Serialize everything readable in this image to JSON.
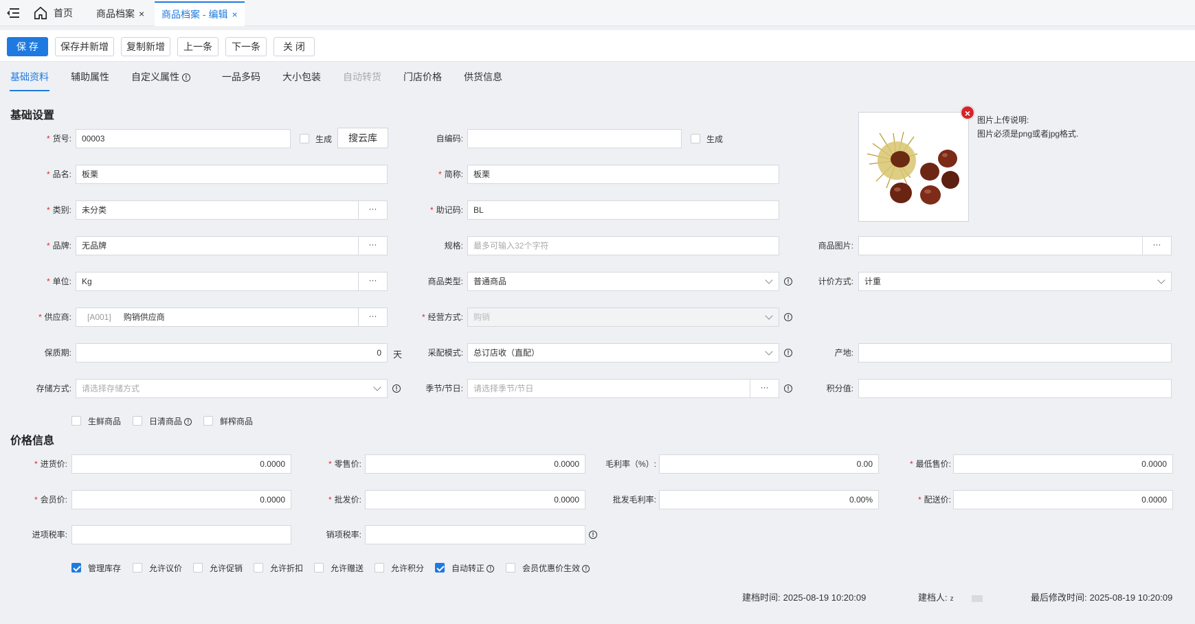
{
  "tabs": {
    "home": "首页",
    "items": [
      {
        "label": "商品档案",
        "close": "×"
      },
      {
        "label": "商品档案 - 编辑",
        "close": "×"
      }
    ]
  },
  "toolbar": {
    "save": "保 存",
    "save_new": "保存并新增",
    "copy_new": "复制新增",
    "prev": "上一条",
    "next": "下一条",
    "close": "关 闭"
  },
  "subtabs": [
    "基础资料",
    "辅助属性",
    "自定义属性",
    "一品多码",
    "大小包装",
    "自动转货",
    "门店价格",
    "供货信息"
  ],
  "basic": {
    "title": "基础设置",
    "required_mark": "*",
    "item_no": {
      "label": "货号:",
      "value": "00003",
      "gen_label": "生成",
      "search_btn": "搜云库"
    },
    "self_code": {
      "label": "自编码:",
      "value": "",
      "gen_label": "生成"
    },
    "name": {
      "label": "品名:",
      "value": "板栗"
    },
    "short_name": {
      "label": "简称:",
      "value": "板栗"
    },
    "category": {
      "label": "类别:",
      "value": "未分类"
    },
    "mnemonic": {
      "label": "助记码:",
      "value": "BL"
    },
    "brand": {
      "label": "品牌:",
      "value": "无品牌"
    },
    "spec": {
      "label": "规格:",
      "placeholder": "最多可输入32个字符"
    },
    "product_image": {
      "label": "商品图片:",
      "value": ""
    },
    "unit": {
      "label": "单位:",
      "value": "Kg"
    },
    "product_type": {
      "label": "商品类型:",
      "value": "普通商品"
    },
    "pricing_method": {
      "label": "计价方式:",
      "value": "计重"
    },
    "supplier": {
      "label": "供应商:",
      "code": "[A001]",
      "value": "购销供应商"
    },
    "business_mode": {
      "label": "经营方式:",
      "value": "购销"
    },
    "shelf_life": {
      "label": "保质期:",
      "value": "0",
      "unit": "天"
    },
    "purchase_mode": {
      "label": "采配模式:",
      "value": "总订店收（直配）"
    },
    "origin": {
      "label": "产地:",
      "value": ""
    },
    "storage": {
      "label": "存储方式:",
      "placeholder": "请选择存储方式"
    },
    "season": {
      "label": "季节/节日:",
      "placeholder": "请选择季节/节日"
    },
    "points": {
      "label": "积分值:",
      "value": ""
    },
    "dots": "···",
    "info": "!",
    "flags": [
      "生鲜商品",
      "日清商品",
      "鲜榨商品"
    ]
  },
  "image": {
    "note_title": "图片上传说明:",
    "note_text": "图片必须是png或者jpg格式.",
    "delete": "×"
  },
  "price": {
    "title": "价格信息",
    "purchase": {
      "label": "进货价:",
      "value": "0.0000"
    },
    "retail": {
      "label": "零售价:",
      "value": "0.0000"
    },
    "margin": {
      "label": "毛利率（%）:",
      "value": "0.00"
    },
    "min_price": {
      "label": "最低售价:",
      "value": "0.0000"
    },
    "member": {
      "label": "会员价:",
      "value": "0.0000"
    },
    "wholesale": {
      "label": "批发价:",
      "value": "0.0000"
    },
    "wholesale_margin": {
      "label": "批发毛利率:",
      "value": "0.00%"
    },
    "delivery": {
      "label": "配送价:",
      "value": "0.0000"
    },
    "input_tax": {
      "label": "进项税率:",
      "value": ""
    },
    "output_tax": {
      "label": "销项税率:",
      "value": ""
    }
  },
  "options": [
    {
      "label": "管理库存",
      "checked": true
    },
    {
      "label": "允许议价",
      "checked": false
    },
    {
      "label": "允许促销",
      "checked": false
    },
    {
      "label": "允许折扣",
      "checked": false
    },
    {
      "label": "允许赠送",
      "checked": false
    },
    {
      "label": "允许积分",
      "checked": false
    },
    {
      "label": "自动转正",
      "checked": true
    },
    {
      "label": "会员优惠价生效",
      "checked": false
    }
  ],
  "footer": {
    "created_label": "建档时间:",
    "created": "2025-08-19 10:20:09",
    "creator_label": "建档人:",
    "creator": "z",
    "modified_label": "最后修改时间:",
    "modified": "2025-08-19 10:20:09"
  },
  "colors": {
    "accent": "#1e7ae0",
    "required": "#e0262b"
  }
}
